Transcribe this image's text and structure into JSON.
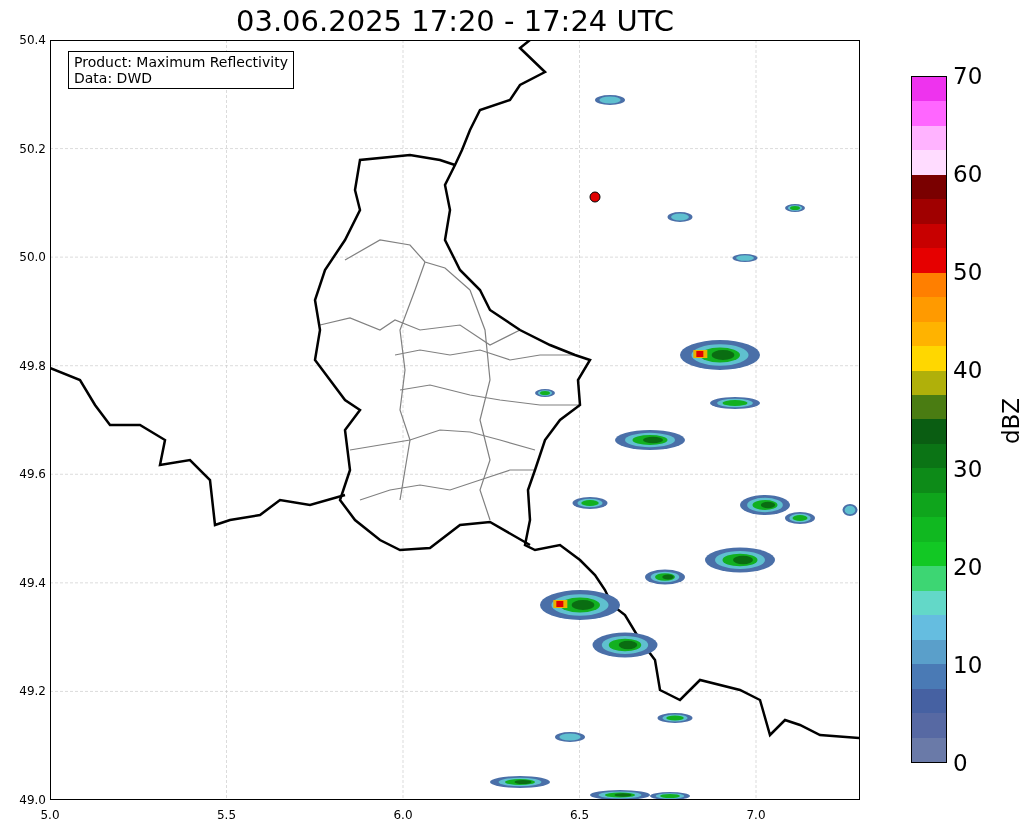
{
  "title": "03.06.2025 17:20 - 17:24 UTC",
  "info_box": [
    "Product: Maximum Reflectivity",
    "Data: DWD"
  ],
  "x_ticks": [
    "5.0",
    "5.5",
    "6.0",
    "6.5",
    "7.0"
  ],
  "y_ticks": [
    "50.4",
    "50.2",
    "50.0",
    "49.8",
    "49.6",
    "49.4",
    "49.2",
    "49.0"
  ],
  "colorbar": {
    "label": "dBZ",
    "ticks": [
      "70",
      "60",
      "50",
      "40",
      "30",
      "20",
      "10",
      "0"
    ],
    "bins": [
      {
        "color": "#6a7aa8"
      },
      {
        "color": "#5769a3"
      },
      {
        "color": "#4661a2"
      },
      {
        "color": "#4a7ab5"
      },
      {
        "color": "#5a9fca"
      },
      {
        "color": "#65bde0"
      },
      {
        "color": "#63d8c8"
      },
      {
        "color": "#3dd673"
      },
      {
        "color": "#12c824"
      },
      {
        "color": "#10b820"
      },
      {
        "color": "#0fa51c"
      },
      {
        "color": "#0d8b18"
      },
      {
        "color": "#0b7415"
      },
      {
        "color": "#0a5d12"
      },
      {
        "color": "#4a7c12"
      },
      {
        "color": "#b0b00a"
      },
      {
        "color": "#ffd700"
      },
      {
        "color": "#ffb300"
      },
      {
        "color": "#ff9a00"
      },
      {
        "color": "#ff7f00"
      },
      {
        "color": "#e60000"
      },
      {
        "color": "#c80000"
      },
      {
        "color": "#a00000"
      },
      {
        "color": "#7a0000"
      },
      {
        "color": "#ffdcff"
      },
      {
        "color": "#ffb3ff"
      },
      {
        "color": "#ff66ff"
      },
      {
        "color": "#ee33ee"
      }
    ]
  }
}
